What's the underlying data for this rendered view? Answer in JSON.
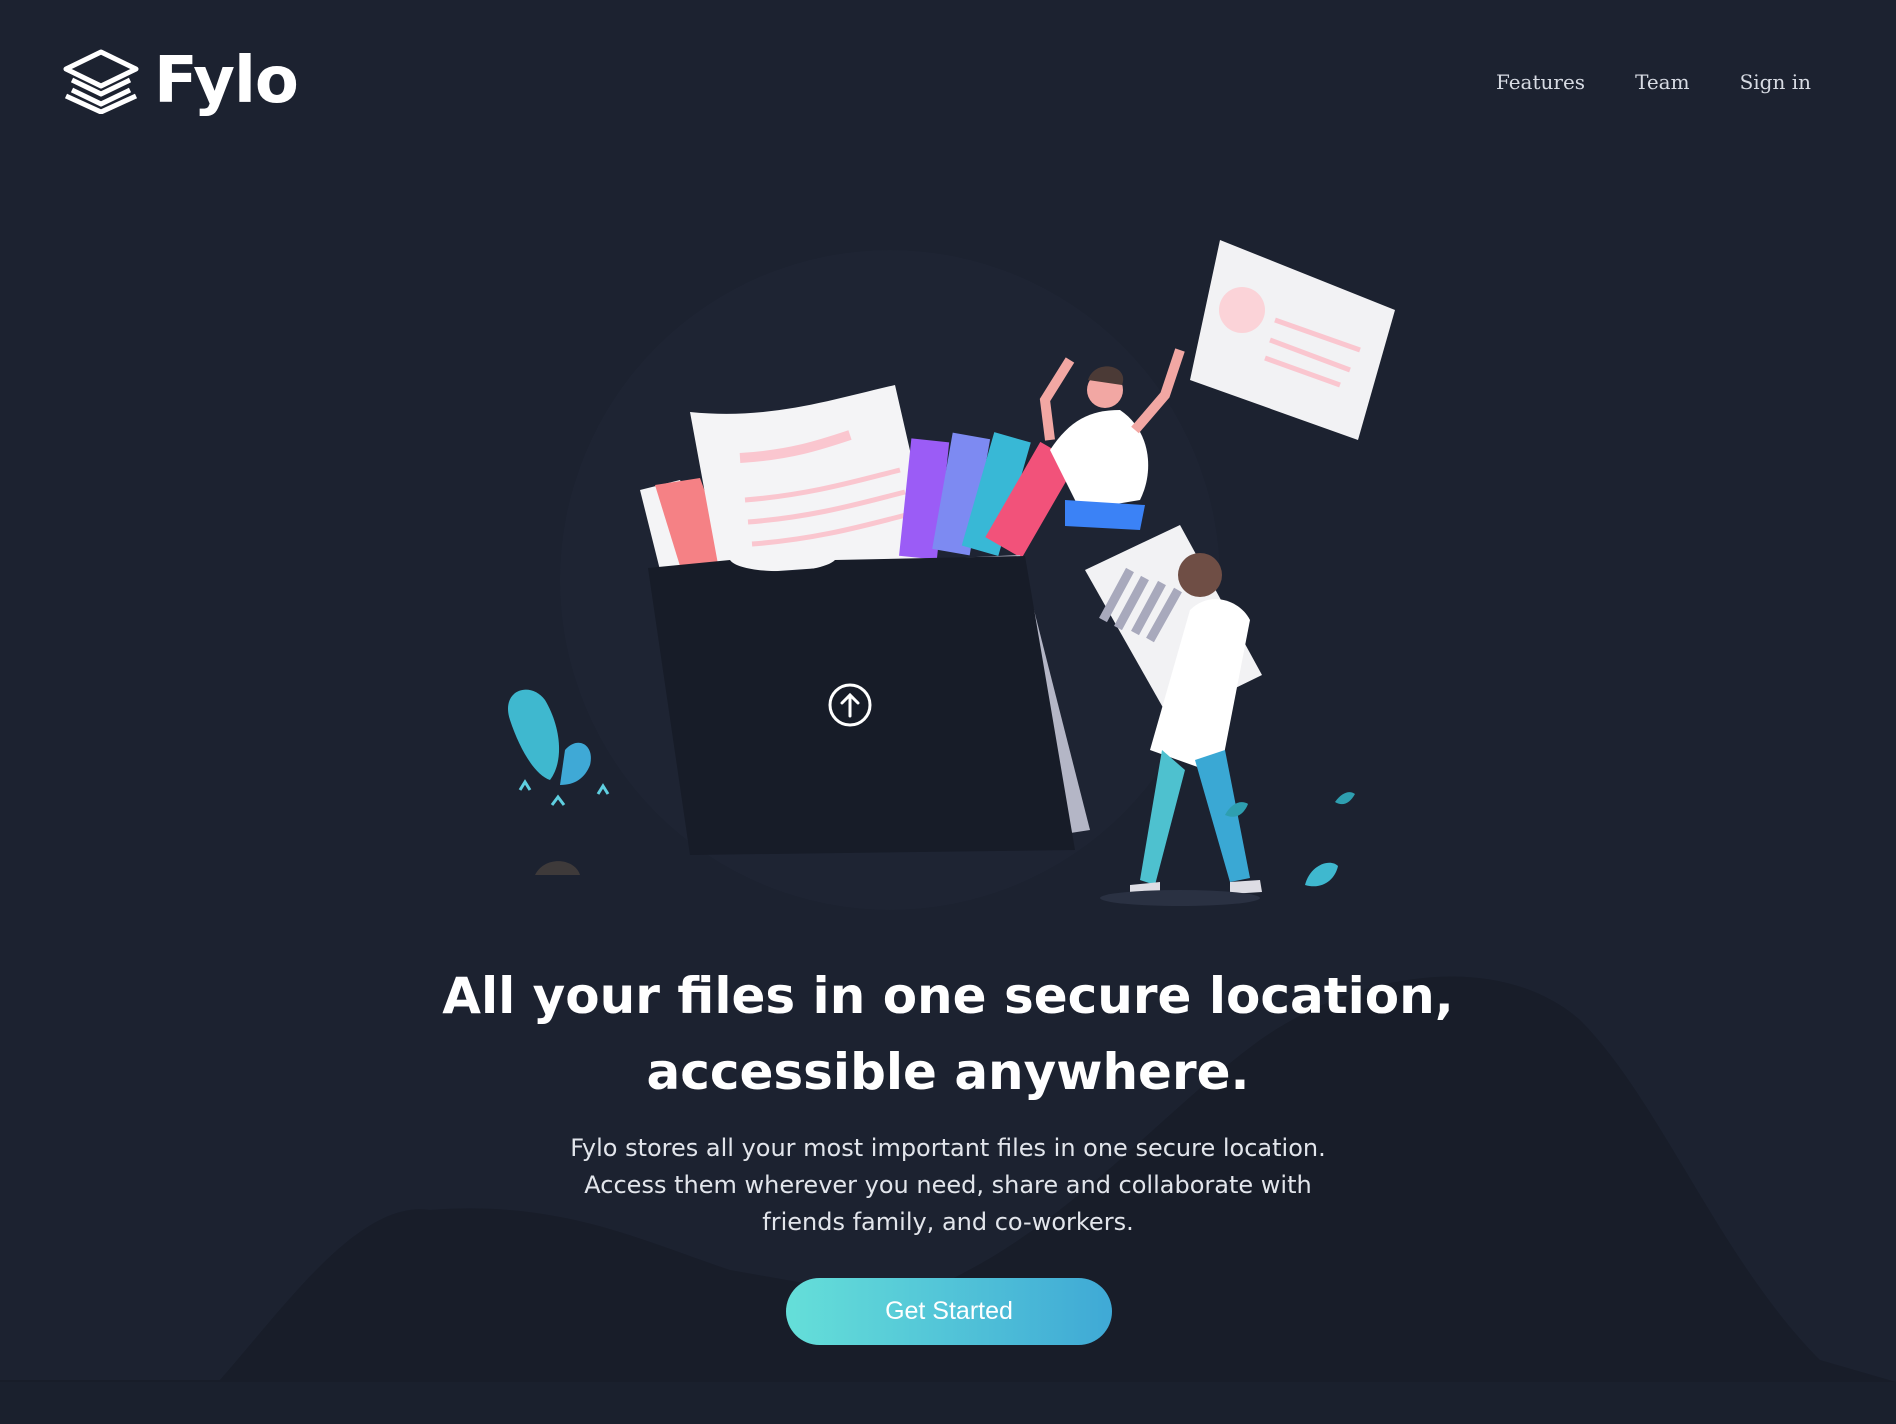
{
  "brand": {
    "name": "Fylo"
  },
  "nav": [
    {
      "label": "Features"
    },
    {
      "label": "Team"
    },
    {
      "label": "Sign in"
    }
  ],
  "hero": {
    "title": "All your files in one secure location, accessible anywhere.",
    "description": "Fylo stores all your most important files in one secure location. Access them wherever you need, share and collaborate with friends family, and co-workers.",
    "cta_label": "Get Started"
  },
  "colors": {
    "background": "#1c2230",
    "accent_start": "#65dfd9",
    "accent_end": "#3fa9d6"
  },
  "icons": [
    "logo-layers-icon",
    "upload-arrow-icon"
  ]
}
